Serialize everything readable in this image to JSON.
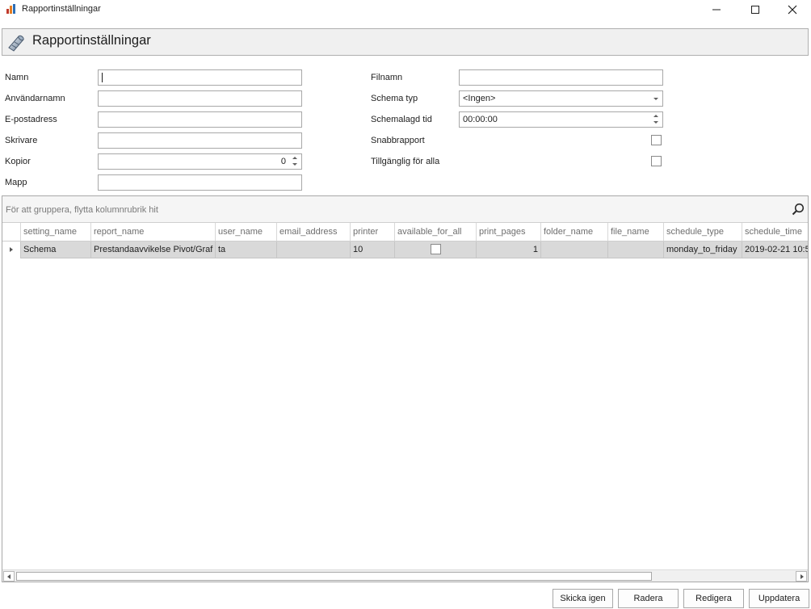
{
  "window": {
    "title": "Rapportinställningar"
  },
  "header": {
    "title": "Rapportinställningar"
  },
  "form": {
    "name_label": "Namn",
    "name_value": "",
    "username_label": "Användarnamn",
    "username_value": "",
    "email_label": "E-postadress",
    "email_value": "",
    "printer_label": "Skrivare",
    "printer_value": "",
    "copies_label": "Kopior",
    "copies_value": "0",
    "folder_label": "Mapp",
    "folder_value": "",
    "filename_label": "Filnamn",
    "filename_value": "",
    "schema_type_label": "Schema typ",
    "schema_type_value": "<Ingen>",
    "schedule_time_label": "Schemalagd tid",
    "schedule_time_value": "00:00:00",
    "quick_report_label": "Snabbrapport",
    "quick_report_checked": false,
    "available_all_label": "Tillgänglig för alla",
    "available_all_checked": false
  },
  "grid": {
    "group_hint": "För att gruppera, flytta kolumnrubrik hit",
    "columns": [
      "setting_name",
      "report_name",
      "user_name",
      "email_address",
      "printer",
      "available_for_all",
      "print_pages",
      "folder_name",
      "file_name",
      "schedule_type",
      "schedule_time"
    ],
    "rows": [
      {
        "setting_name": "Schema",
        "report_name": "Prestandaavvikelse Pivot/Graf",
        "user_name": "ta",
        "email_address": "",
        "printer": "10",
        "available_for_all": false,
        "print_pages": "1",
        "folder_name": "",
        "file_name": "",
        "schedule_type": "monday_to_friday",
        "schedule_time": "2019-02-21 10:5"
      }
    ]
  },
  "buttons": {
    "resend": "Skicka igen",
    "delete": "Radera",
    "edit": "Redigera",
    "update": "Uppdatera"
  },
  "icons": {
    "app": "report-chart-icon",
    "header": "settings-tube-icon",
    "search": "search-icon"
  }
}
